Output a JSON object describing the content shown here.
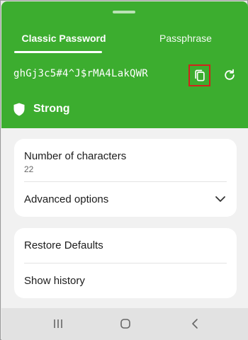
{
  "tabs": [
    {
      "label": "Classic Password",
      "active": true
    },
    {
      "label": "Passphrase",
      "active": false
    }
  ],
  "generated_password": "ghGj3c5#4^J$rMA4LakQWR",
  "strength": {
    "label": "Strong",
    "icon": "shield-icon"
  },
  "settings_card": {
    "number_of_characters_label": "Number of characters",
    "number_of_characters_value": "22",
    "advanced_options_label": "Advanced options"
  },
  "actions_card": {
    "restore_defaults_label": "Restore Defaults",
    "show_history_label": "Show history"
  },
  "icons": {
    "copy": "copy-icon",
    "refresh": "refresh-icon",
    "chevron": "chevron-down-icon",
    "recents": "recents-icon",
    "home": "home-icon",
    "back": "back-icon"
  },
  "colors": {
    "header_green": "#3cad2f",
    "highlight_red": "#d1231b",
    "card_bg": "#ffffff",
    "page_bg": "#f1f1f1"
  }
}
